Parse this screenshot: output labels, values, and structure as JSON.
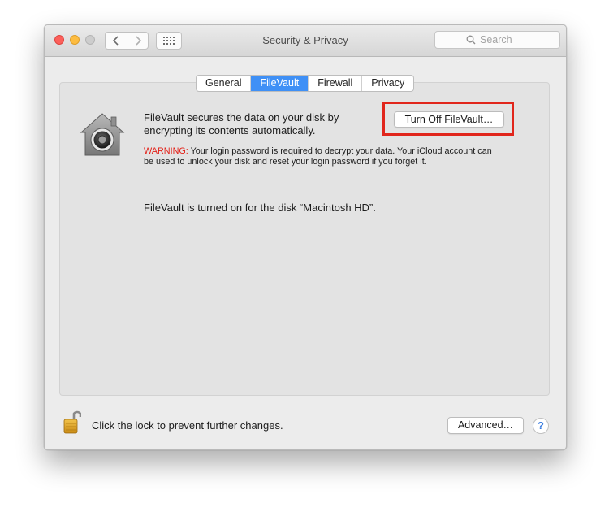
{
  "window": {
    "title": "Security & Privacy",
    "search_placeholder": "Search",
    "buttons": {
      "back_icon": "chevron-left",
      "forward_icon": "chevron-right",
      "grid_icon": "show-all-grid"
    }
  },
  "tabs": [
    {
      "label": "General",
      "active": false
    },
    {
      "label": "FileVault",
      "active": true
    },
    {
      "label": "Firewall",
      "active": false
    },
    {
      "label": "Privacy",
      "active": false
    }
  ],
  "filevault": {
    "description_line1": "FileVault secures the data on your disk by",
    "description_line2": "encrypting its contents automatically.",
    "turn_off_button": "Turn Off FileVault…",
    "warning_label": "WARNING:",
    "warning_text": " Your login password is required to decrypt your data. Your iCloud account can be used to unlock your disk and reset your login password if you forget it.",
    "status": "FileVault is turned on for the disk “Macintosh HD”."
  },
  "footer": {
    "lock_text": "Click the lock to prevent further changes.",
    "advanced_button": "Advanced…",
    "help_label": "?"
  },
  "colors": {
    "accent_tab": "#3f90f6",
    "warning": "#e31f16",
    "highlight_box": "#e1261c"
  }
}
